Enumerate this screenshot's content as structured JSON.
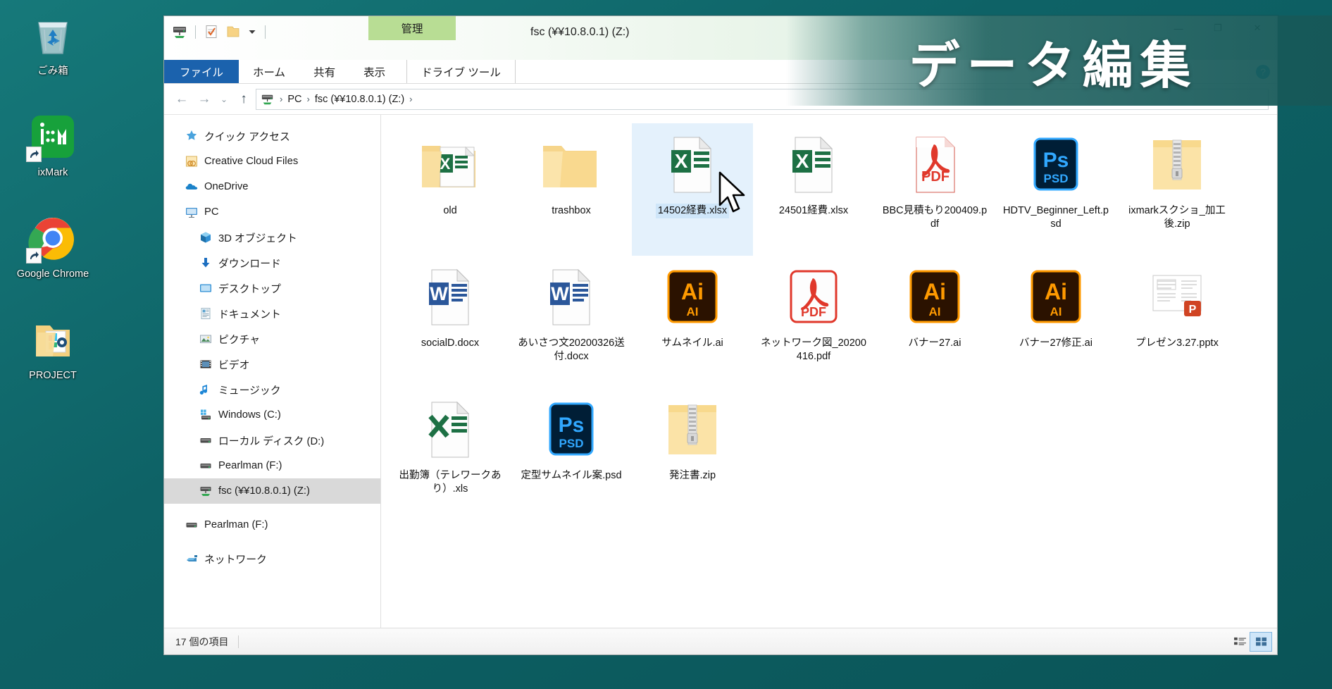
{
  "desktop": {
    "icons": [
      {
        "label": "ごみ箱",
        "icon": "recycle-bin-icon",
        "shortcut": false
      },
      {
        "label": "ixMark",
        "icon": "ixmark-app-icon",
        "shortcut": true
      },
      {
        "label": "Google Chrome",
        "icon": "google-chrome-icon",
        "shortcut": true
      },
      {
        "label": "PROJECT",
        "icon": "project-folder-icon",
        "shortcut": false
      }
    ],
    "background_color": "#0e6266"
  },
  "overlay": {
    "caption": "データ編集"
  },
  "explorer": {
    "window_title": "fsc (¥¥10.8.0.1) (Z:)",
    "quick_access_toolbar": [
      {
        "name": "network-drive-icon"
      },
      {
        "name": "properties-icon"
      },
      {
        "name": "new-folder-icon"
      },
      {
        "name": "customize-caret-icon"
      }
    ],
    "window_controls": [
      "—",
      "❐",
      "✕"
    ],
    "contextual_tab_group": "管理",
    "ribbon_tabs": [
      {
        "label": "ファイル",
        "active": true,
        "kind": "file"
      },
      {
        "label": "ホーム",
        "active": false,
        "kind": "normal"
      },
      {
        "label": "共有",
        "active": false,
        "kind": "normal"
      },
      {
        "label": "表示",
        "active": false,
        "kind": "normal"
      },
      {
        "label": "ドライブ ツール",
        "active": false,
        "kind": "contextual"
      }
    ],
    "help_label": "?",
    "address": {
      "back_icon": "arrow-left-icon",
      "forward_icon": "arrow-right-icon",
      "recent_icon": "chevron-down-icon",
      "up_icon": "arrow-up-icon",
      "location_icon": "network-drive-icon",
      "crumbs": [
        "PC",
        "fsc (¥¥10.8.0.1) (Z:)"
      ],
      "trailing_crumb_hint": "fsc (¥¥10.…",
      "separator": "›"
    },
    "nav_pane": [
      {
        "label": "クイック アクセス",
        "icon": "star-pin-icon",
        "indent": false,
        "selected": false
      },
      {
        "label": "Creative Cloud Files",
        "icon": "creative-cloud-folder-icon",
        "indent": false,
        "selected": false
      },
      {
        "label": "OneDrive",
        "icon": "onedrive-cloud-icon",
        "indent": false,
        "selected": false
      },
      {
        "label": "PC",
        "icon": "this-pc-icon",
        "indent": false,
        "selected": false
      },
      {
        "label": "3D オブジェクト",
        "icon": "3d-objects-icon",
        "indent": true,
        "selected": false
      },
      {
        "label": "ダウンロード",
        "icon": "downloads-icon",
        "indent": true,
        "selected": false
      },
      {
        "label": "デスクトップ",
        "icon": "desktop-icon",
        "indent": true,
        "selected": false
      },
      {
        "label": "ドキュメント",
        "icon": "documents-icon",
        "indent": true,
        "selected": false
      },
      {
        "label": "ピクチャ",
        "icon": "pictures-icon",
        "indent": true,
        "selected": false
      },
      {
        "label": "ビデオ",
        "icon": "videos-icon",
        "indent": true,
        "selected": false
      },
      {
        "label": "ミュージック",
        "icon": "music-icon",
        "indent": true,
        "selected": false
      },
      {
        "label": "Windows (C:)",
        "icon": "windows-drive-icon",
        "indent": true,
        "selected": false
      },
      {
        "label": "ローカル ディスク (D:)",
        "icon": "local-disk-icon",
        "indent": true,
        "selected": false
      },
      {
        "label": "Pearlman (F:)",
        "icon": "local-disk-icon",
        "indent": true,
        "selected": false
      },
      {
        "label": "fsc (¥¥10.8.0.1) (Z:)",
        "icon": "network-drive-icon",
        "indent": true,
        "selected": true
      },
      {
        "label": "Pearlman (F:)",
        "icon": "local-disk-icon",
        "indent": false,
        "selected": false,
        "gap_before": true
      },
      {
        "label": "ネットワーク",
        "icon": "network-icon",
        "indent": false,
        "selected": false,
        "gap_before": true
      }
    ],
    "files": [
      {
        "label": "old",
        "type": "folder-excel",
        "selected": false
      },
      {
        "label": "trashbox",
        "type": "folder",
        "selected": false
      },
      {
        "label": "14502経費.xlsx",
        "type": "xlsx",
        "selected": true
      },
      {
        "label": "24501経費.xlsx",
        "type": "xlsx",
        "selected": false
      },
      {
        "label": "BBC見積もり200409.pdf",
        "type": "pdf",
        "selected": false
      },
      {
        "label": "HDTV_Beginner_Left.psd",
        "type": "psd",
        "selected": false
      },
      {
        "label": "ixmarkスクショ_加工後.zip",
        "type": "zip",
        "selected": false
      },
      {
        "label": "socialD.docx",
        "type": "docx",
        "selected": false
      },
      {
        "label": "あいさつ文20200326送付.docx",
        "type": "docx",
        "selected": false
      },
      {
        "label": "サムネイル.ai",
        "type": "ai",
        "selected": false
      },
      {
        "label": "ネットワーク図_20200416.pdf",
        "type": "pdf-ai",
        "selected": false
      },
      {
        "label": "バナー27.ai",
        "type": "ai",
        "selected": false
      },
      {
        "label": "バナー27修正.ai",
        "type": "ai",
        "selected": false
      },
      {
        "label": "プレゼン3.27.pptx",
        "type": "pptx-preview",
        "selected": false
      },
      {
        "label": "出勤簿（テレワークあり）.xls",
        "type": "xls",
        "selected": false
      },
      {
        "label": "定型サムネイル案.psd",
        "type": "psd",
        "selected": false
      },
      {
        "label": "発注書.zip",
        "type": "zip",
        "selected": false
      }
    ],
    "status": {
      "item_count": "17 個の項目",
      "view_buttons": [
        {
          "name": "details-view-button",
          "active": false
        },
        {
          "name": "large-icons-view-button",
          "active": true
        }
      ]
    }
  },
  "colors": {
    "desktop_teal": "#0e6266",
    "file_tab_blue": "#1b62ad",
    "contextual_green": "#b8dd94",
    "selection_blue": "#cfe6f9",
    "excel_green": "#1d7044",
    "word_blue": "#2b579a",
    "pdf_red": "#e0382b",
    "psd_navy": "#001e36",
    "psd_cyan": "#31a8ff",
    "ai_brown": "#330000",
    "ai_orange": "#ff9a00",
    "zip_yellow": "#f7d384",
    "ppt_orange": "#d04423"
  }
}
